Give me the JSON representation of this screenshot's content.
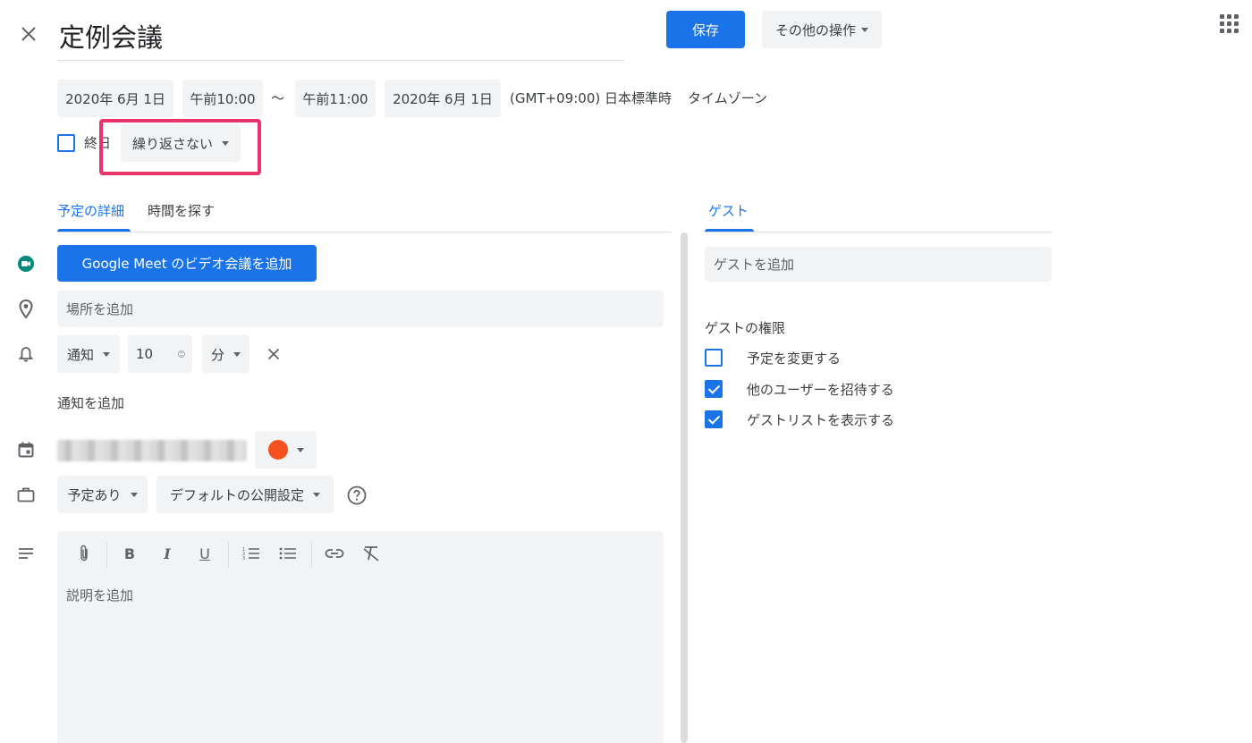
{
  "header": {
    "title": "定例会議",
    "save_label": "保存",
    "more_actions_label": "その他の操作"
  },
  "datetime": {
    "start_date": "2020年 6月 1日",
    "start_time": "午前10:00",
    "separator": "〜",
    "end_time": "午前11:00",
    "end_date": "2020年 6月 1日",
    "timezone_text": "(GMT+09:00) 日本標準時",
    "timezone_link": "タイムゾーン",
    "all_day_label": "終日",
    "repeat_label": "繰り返さない"
  },
  "tabs": {
    "details": "予定の詳細",
    "find_time": "時間を探す",
    "guests": "ゲスト"
  },
  "details": {
    "meet_button": "Google Meet のビデオ会議を追加",
    "location_placeholder": "場所を追加",
    "notification_type": "通知",
    "notification_value": "10",
    "notification_unit": "分",
    "add_notification": "通知を追加",
    "busy_status": "予定あり",
    "visibility": "デフォルトの公開設定",
    "description_placeholder": "説明を追加"
  },
  "guests": {
    "add_guests_placeholder": "ゲストを追加",
    "permissions_heading": "ゲストの権限",
    "permissions": [
      {
        "label": "予定を変更する",
        "checked": false
      },
      {
        "label": "他のユーザーを招待する",
        "checked": true
      },
      {
        "label": "ゲストリストを表示する",
        "checked": true
      }
    ]
  },
  "colors": {
    "accent": "#1a73e8",
    "highlight": "#e8336b",
    "event_color": "#f4511e",
    "meet_green": "#00897b"
  }
}
